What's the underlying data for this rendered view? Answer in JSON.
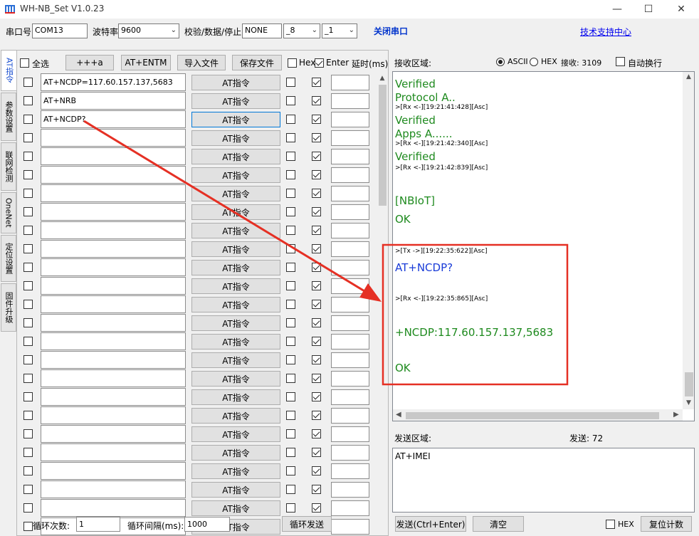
{
  "window": {
    "title": "WH-NB_Set V1.0.23",
    "minimize": "—",
    "maximize": "☐",
    "close": "✕"
  },
  "toolbar": {
    "port_label": "串口号",
    "port_value": "COM13",
    "baud_label": "波特率",
    "baud_value": "9600",
    "check_label": "校验/数据/停止",
    "parity_value": "NONE",
    "databits_value": "_8",
    "stopbits_value": "_1",
    "close_port": "关闭串口",
    "support_link": "技术支持中心"
  },
  "tabs": [
    "AT指令",
    "参数设置",
    "联网检测",
    "OneNet",
    "定位设置",
    "固件升级"
  ],
  "at_panel": {
    "select_all": "全选",
    "btn_plus": "+++a",
    "btn_entm": "AT+ENTM",
    "btn_import": "导入文件",
    "btn_save": "保存文件",
    "hex_label": "Hex",
    "enter_label": "Enter",
    "delay_label": "延时(ms)",
    "at_button_label": "AT指令",
    "commands": [
      "AT+NCDP=117.60.157.137,5683",
      "AT+NRB",
      "AT+NCDP?",
      "",
      "",
      "",
      "",
      "",
      "",
      "",
      "",
      "",
      "",
      "",
      "",
      "",
      "",
      "",
      "",
      "",
      "",
      "",
      "",
      "",
      ""
    ],
    "loop_count_label": "循环次数:",
    "loop_count_value": "1",
    "loop_interval_label": "循环间隔(ms):",
    "loop_interval_value": "1000",
    "loop_send": "循环发送"
  },
  "receive": {
    "label": "接收区域:",
    "ascii": "ASCII",
    "hex": "HEX",
    "recv_count": "接收: 3109",
    "auto_wrap": "自动换行",
    "lines": [
      {
        "type": "green",
        "text": "Verified"
      },
      {
        "type": "green",
        "text": "Protocol A.."
      },
      {
        "type": "ts",
        "text": ">[Rx <-][19:21:41:428][Asc]"
      },
      {
        "type": "green",
        "text": "Verified"
      },
      {
        "type": "green",
        "text": "Apps A......"
      },
      {
        "type": "ts",
        "text": ">[Rx <-][19:21:42:340][Asc]"
      },
      {
        "type": "green",
        "text": "Verified"
      },
      {
        "type": "ts",
        "text": ">[Rx <-][19:21:42:839][Asc]"
      },
      {
        "type": "green",
        "text": "[NBIoT]"
      },
      {
        "type": "green",
        "text": "OK"
      },
      {
        "type": "ts",
        "text": ">[Tx ->][19:22:35:622][Asc]"
      },
      {
        "type": "blue",
        "text": "AT+NCDP?"
      },
      {
        "type": "ts",
        "text": ">[Rx <-][19:22:35:865][Asc]"
      },
      {
        "type": "green",
        "text": "+NCDP:117.60.157.137,5683"
      },
      {
        "type": "green",
        "text": "OK"
      }
    ]
  },
  "send": {
    "label": "发送区域:",
    "send_count": "发送: 72",
    "content": "AT+IMEI",
    "send_button": "发送(Ctrl+Enter)",
    "clear_button": "清空",
    "hex_label": "HEX",
    "reset_button": "复位计数"
  },
  "colors": {
    "green_text": "#1e8a1e",
    "blue_text": "#1a3cd8",
    "highlight_red": "#e53024",
    "close_port_blue": "#0033cc"
  }
}
